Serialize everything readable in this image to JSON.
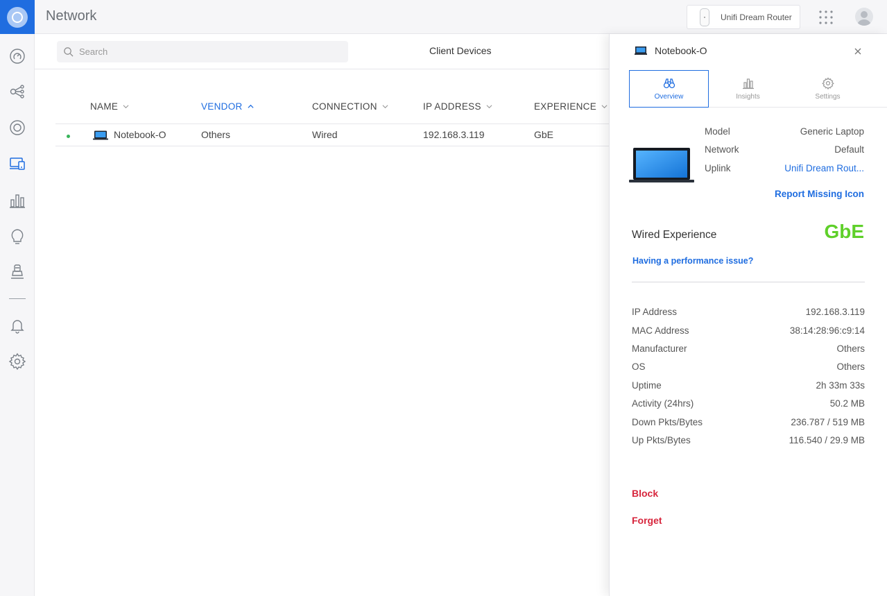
{
  "app": {
    "title": "Network"
  },
  "topbar": {
    "device_name": "Unifi Dream Router",
    "icons": [
      "router-icon",
      "apps-grid-icon",
      "user-avatar"
    ]
  },
  "sidebar": {
    "items": [
      {
        "name": "dashboard-icon"
      },
      {
        "name": "topology-icon"
      },
      {
        "name": "devices-icon"
      },
      {
        "name": "clients-icon",
        "active": true
      },
      {
        "name": "statistics-icon"
      },
      {
        "name": "insights-icon"
      },
      {
        "name": "system-log-icon"
      },
      {
        "name": "notifications-icon"
      },
      {
        "name": "settings-icon"
      }
    ]
  },
  "search": {
    "placeholder": "Search",
    "value": ""
  },
  "page": {
    "title": "Client Devices"
  },
  "table": {
    "columns": [
      {
        "label": "NAME",
        "sort": "none"
      },
      {
        "label": "VENDOR",
        "sort": "asc",
        "active": true
      },
      {
        "label": "CONNECTION",
        "sort": "none"
      },
      {
        "label": "IP ADDRESS",
        "sort": "none"
      },
      {
        "label": "EXPERIENCE",
        "sort": "none"
      }
    ],
    "rows": [
      {
        "status": "online",
        "name": "Notebook-O",
        "vendor": "Others",
        "connection": "Wired",
        "ip": "192.168.3.119",
        "experience": "GbE"
      }
    ]
  },
  "drawer": {
    "title": "Notebook-O",
    "tabs": [
      {
        "label": "Overview",
        "active": true
      },
      {
        "label": "Insights"
      },
      {
        "label": "Settings"
      }
    ],
    "summary": {
      "model_label": "Model",
      "model_value": "Generic Laptop",
      "network_label": "Network",
      "network_value": "Default",
      "uplink_label": "Uplink",
      "uplink_value": "Unifi Dream Rout..."
    },
    "report_missing_icon": "Report Missing Icon",
    "experience_title": "Wired Experience",
    "experience_value": "GbE",
    "performance_link": "Having a performance issue?",
    "details": [
      {
        "label": "IP Address",
        "value": "192.168.3.119"
      },
      {
        "label": "MAC Address",
        "value": "38:14:28:96:c9:14"
      },
      {
        "label": "Manufacturer",
        "value": "Others"
      },
      {
        "label": "OS",
        "value": "Others"
      },
      {
        "label": "Uptime",
        "value": "2h 33m 33s"
      },
      {
        "label": "Activity (24hrs)",
        "value": "50.2 MB"
      },
      {
        "label": "Down Pkts/Bytes",
        "value": "236.787 / 519 MB"
      },
      {
        "label": "Up Pkts/Bytes",
        "value": "116.540 / 29.9 MB"
      }
    ],
    "actions": {
      "block": "Block",
      "forget": "Forget"
    }
  },
  "colors": {
    "accent": "#1f6de0",
    "experience": "#5fd02a",
    "danger": "#d7263d",
    "online": "#38b45a"
  }
}
